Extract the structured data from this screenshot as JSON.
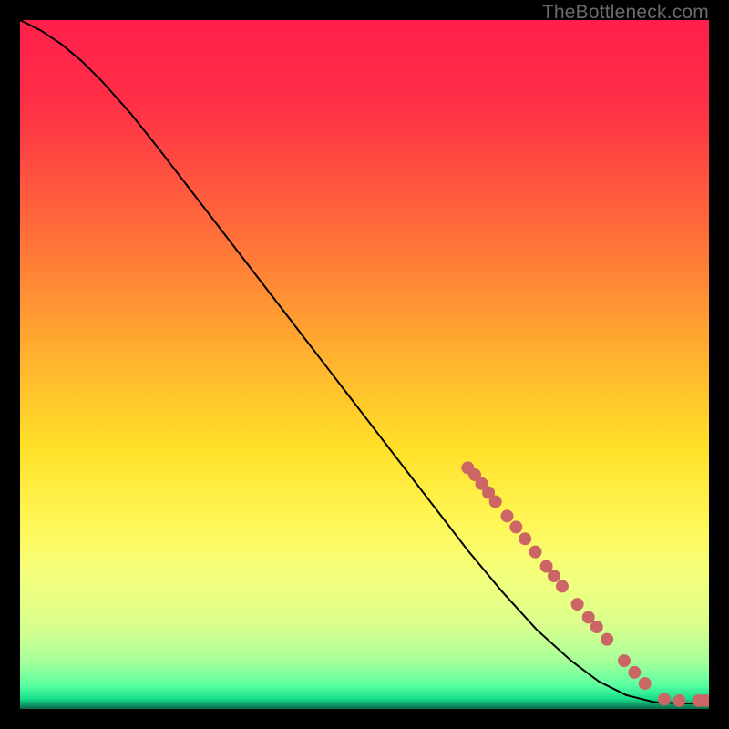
{
  "watermark": "TheBottleneck.com",
  "chart_data": {
    "type": "line",
    "title": "",
    "xlabel": "",
    "ylabel": "",
    "xlim": [
      0,
      100
    ],
    "ylim": [
      0,
      100
    ],
    "gradient_stops": [
      {
        "offset": 0,
        "color": "#ff1f4b"
      },
      {
        "offset": 0.12,
        "color": "#ff2f47"
      },
      {
        "offset": 0.3,
        "color": "#ff6a3a"
      },
      {
        "offset": 0.48,
        "color": "#ffae2f"
      },
      {
        "offset": 0.62,
        "color": "#ffe028"
      },
      {
        "offset": 0.72,
        "color": "#fff552"
      },
      {
        "offset": 0.8,
        "color": "#f6ff7a"
      },
      {
        "offset": 0.88,
        "color": "#d9ff8e"
      },
      {
        "offset": 0.93,
        "color": "#a8ff9a"
      },
      {
        "offset": 0.965,
        "color": "#5bffa0"
      },
      {
        "offset": 0.985,
        "color": "#19e08b"
      },
      {
        "offset": 1.0,
        "color": "#0a6a4a"
      }
    ],
    "curve": [
      {
        "x": 0,
        "y": 100
      },
      {
        "x": 3,
        "y": 98.5
      },
      {
        "x": 6,
        "y": 96.5
      },
      {
        "x": 9,
        "y": 94.0
      },
      {
        "x": 12,
        "y": 91.0
      },
      {
        "x": 16,
        "y": 86.5
      },
      {
        "x": 20,
        "y": 81.5
      },
      {
        "x": 25,
        "y": 75.0
      },
      {
        "x": 30,
        "y": 68.5
      },
      {
        "x": 35,
        "y": 62.0
      },
      {
        "x": 40,
        "y": 55.5
      },
      {
        "x": 45,
        "y": 49.0
      },
      {
        "x": 50,
        "y": 42.5
      },
      {
        "x": 55,
        "y": 36.0
      },
      {
        "x": 60,
        "y": 29.5
      },
      {
        "x": 65,
        "y": 23.0
      },
      {
        "x": 70,
        "y": 17.0
      },
      {
        "x": 75,
        "y": 11.5
      },
      {
        "x": 80,
        "y": 7.0
      },
      {
        "x": 84,
        "y": 4.0
      },
      {
        "x": 88,
        "y": 2.0
      },
      {
        "x": 92,
        "y": 1.0
      },
      {
        "x": 96,
        "y": 0.8
      },
      {
        "x": 100,
        "y": 0.8
      }
    ],
    "markers": [
      {
        "x": 65,
        "y": 35
      },
      {
        "x": 66,
        "y": 34
      },
      {
        "x": 67,
        "y": 32.7
      },
      {
        "x": 68,
        "y": 31.4
      },
      {
        "x": 69,
        "y": 30.1
      },
      {
        "x": 70.7,
        "y": 28
      },
      {
        "x": 72,
        "y": 26.4
      },
      {
        "x": 73.3,
        "y": 24.7
      },
      {
        "x": 74.8,
        "y": 22.8
      },
      {
        "x": 76.4,
        "y": 20.7
      },
      {
        "x": 77.5,
        "y": 19.3
      },
      {
        "x": 78.7,
        "y": 17.8
      },
      {
        "x": 80.9,
        "y": 15.2
      },
      {
        "x": 82.5,
        "y": 13.3
      },
      {
        "x": 83.7,
        "y": 11.9
      },
      {
        "x": 85.2,
        "y": 10.1
      },
      {
        "x": 87.7,
        "y": 7.0
      },
      {
        "x": 89.2,
        "y": 5.3
      },
      {
        "x": 90.7,
        "y": 3.7
      },
      {
        "x": 93.5,
        "y": 1.4
      },
      {
        "x": 95.7,
        "y": 1.2
      },
      {
        "x": 98.5,
        "y": 1.2
      },
      {
        "x": 99.5,
        "y": 1.2
      }
    ],
    "marker_color": "#cc6666",
    "marker_radius_px": 7
  }
}
